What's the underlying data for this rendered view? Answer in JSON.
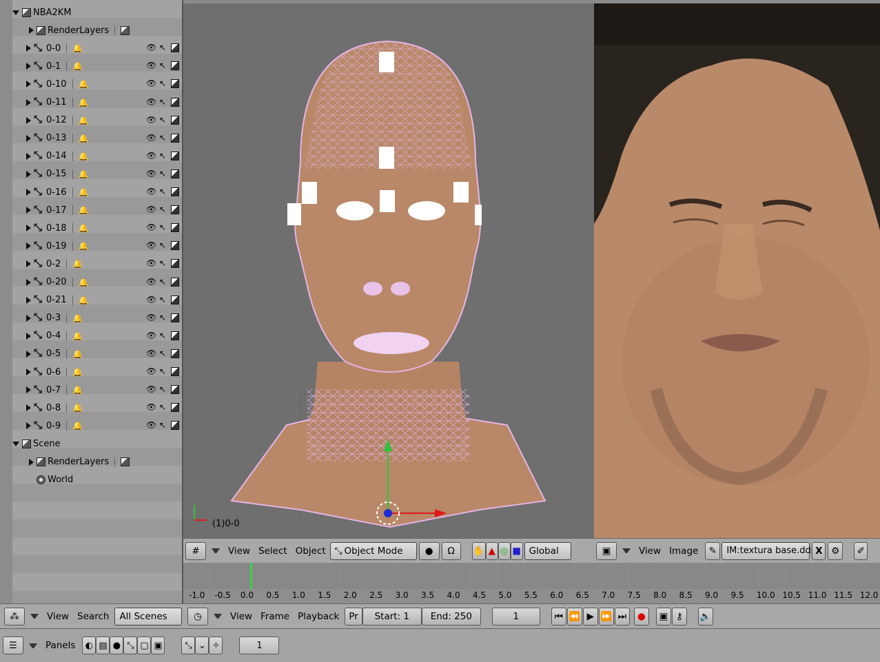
{
  "outliner": {
    "root_scene": "NBA2KM",
    "render_layers": "RenderLayers",
    "armatures": [
      "0-0",
      "0-1",
      "0-10",
      "0-11",
      "0-12",
      "0-13",
      "0-14",
      "0-15",
      "0-16",
      "0-17",
      "0-18",
      "0-19",
      "0-2",
      "0-20",
      "0-21",
      "0-3",
      "0-4",
      "0-5",
      "0-6",
      "0-7",
      "0-8",
      "0-9"
    ],
    "second_scene": "Scene",
    "second_render_layers": "RenderLayers",
    "world": "World"
  },
  "viewport3d": {
    "object_label": "(1)0-0",
    "header": {
      "view": "View",
      "select": "Select",
      "object": "Object",
      "mode": "Object Mode",
      "orientation": "Global"
    }
  },
  "image_editor": {
    "header": {
      "view": "View",
      "image": "Image",
      "image_name": "IM:textura base.dds",
      "close": "X"
    }
  },
  "outliner_header": {
    "view": "View",
    "search": "Search",
    "filter": "All Scenes"
  },
  "timeline": {
    "ticks": [
      "-1.0",
      "-0.5",
      "0.0",
      "0.5",
      "1.0",
      "1.5",
      "2.0",
      "2.5",
      "3.0",
      "3.5",
      "4.0",
      "4.5",
      "5.0",
      "5.5",
      "6.0",
      "6.5",
      "7.0",
      "7.5",
      "8.0",
      "8.5",
      "9.0",
      "9.5",
      "10.0",
      "10.5",
      "11.0",
      "11.5",
      "12.0"
    ],
    "current_frame_pos": 0.0,
    "header": {
      "view": "View",
      "frame": "Frame",
      "playback": "Playback",
      "pr": "Pr",
      "start": "Start: 1",
      "end": "End: 250",
      "current": "1"
    }
  },
  "buttons_header": {
    "panels": "Panels",
    "frame": "1"
  },
  "colors": {
    "skin": "#b88868",
    "wire": "#e6b4e6",
    "bg3d": "#6f6f6f",
    "cursor": "#3bd04a"
  }
}
